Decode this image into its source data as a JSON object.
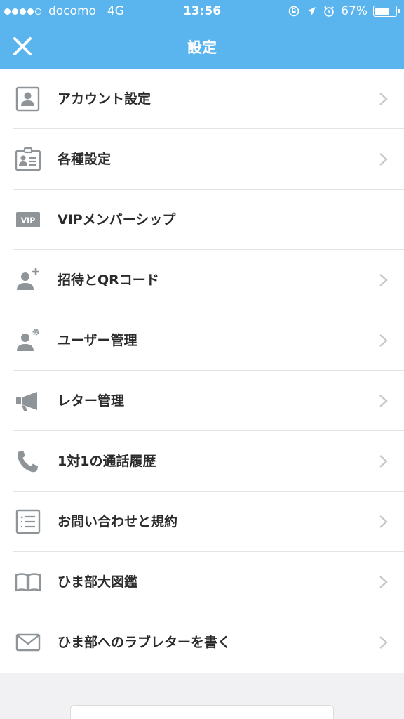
{
  "status_bar": {
    "carrier": "docomo",
    "network": "4G",
    "time": "13:56",
    "battery": "67%",
    "battery_level": 0.67,
    "signal_bars": 4
  },
  "nav": {
    "title": "設定",
    "close_icon": "close-icon"
  },
  "menu": [
    {
      "label": "アカウント設定",
      "icon": "account-icon",
      "chevron": true
    },
    {
      "label": "各種設定",
      "icon": "id-card-icon",
      "chevron": true
    },
    {
      "label": "VIPメンバーシップ",
      "icon": "vip-icon",
      "icon_text": "VIP",
      "chevron": false
    },
    {
      "label": "招待とQRコード",
      "icon": "add-user-icon",
      "chevron": true
    },
    {
      "label": "ユーザー管理",
      "icon": "user-gear-icon",
      "chevron": true
    },
    {
      "label": "レター管理",
      "icon": "megaphone-icon",
      "chevron": true
    },
    {
      "label": "1対1の通話履歴",
      "icon": "phone-icon",
      "chevron": true
    },
    {
      "label": "お問い合わせと規約",
      "icon": "list-icon",
      "chevron": true
    },
    {
      "label": "ひま部大図鑑",
      "icon": "book-icon",
      "chevron": true
    },
    {
      "label": "ひま部へのラブレターを書く",
      "icon": "mail-icon",
      "chevron": true
    }
  ],
  "colors": {
    "header": "#5ab4ee",
    "icon": "#8e9498",
    "chevron": "#c7c7cc"
  }
}
